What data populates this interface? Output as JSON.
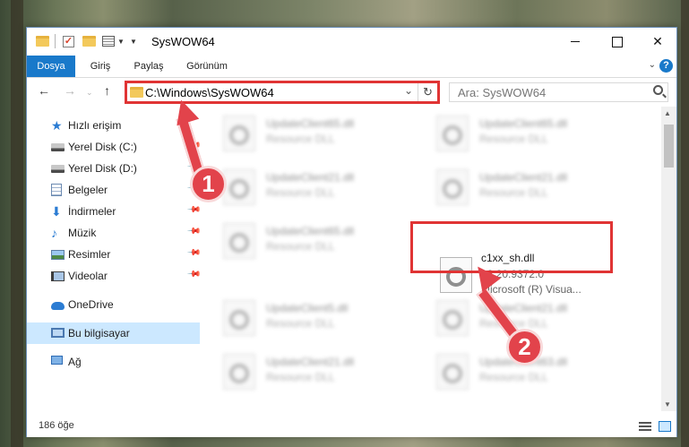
{
  "window": {
    "title": "SysWOW64"
  },
  "ribbon": {
    "tabs": [
      {
        "label": "Dosya",
        "active": true
      },
      {
        "label": "Giriş",
        "active": false
      },
      {
        "label": "Paylaş",
        "active": false
      },
      {
        "label": "Görünüm",
        "active": false
      }
    ],
    "help": "?"
  },
  "address": {
    "path": "C:\\Windows\\SysWOW64",
    "search_placeholder": "Ara: SysWOW64"
  },
  "sidebar": {
    "items": [
      {
        "label": "Hızlı erişim",
        "icon": "star-icon",
        "pinned": false
      },
      {
        "label": "Yerel Disk (C:)",
        "icon": "disk-icon",
        "pinned": true
      },
      {
        "label": "Yerel Disk (D:)",
        "icon": "disk-icon",
        "pinned": true
      },
      {
        "label": "Belgeler",
        "icon": "documents-icon",
        "pinned": true
      },
      {
        "label": "İndirmeler",
        "icon": "download-icon",
        "pinned": true
      },
      {
        "label": "Müzik",
        "icon": "music-icon",
        "pinned": true
      },
      {
        "label": "Resimler",
        "icon": "pictures-icon",
        "pinned": true
      },
      {
        "label": "Videolar",
        "icon": "videos-icon",
        "pinned": true
      },
      {
        "label": "OneDrive",
        "icon": "onedrive-icon",
        "pinned": false
      },
      {
        "label": "Bu bilgisayar",
        "icon": "this-pc-icon",
        "pinned": false,
        "selected": true
      },
      {
        "label": "Ağ",
        "icon": "network-icon",
        "pinned": false
      }
    ]
  },
  "files": [
    {
      "name": "UpdateClient65.dll",
      "type": "Resource DLL"
    },
    {
      "name": "UpdateClient65.dll",
      "type": "Resource DLL"
    },
    {
      "name": "UpdateClient21.dll",
      "type": "Resource DLL"
    },
    {
      "name": "UpdateClient21.dll",
      "type": "Resource DLL"
    },
    {
      "name": "UpdateClient65.dll",
      "type": "Resource DLL"
    },
    {
      "name": "c1xx_sh.dll",
      "version": "12.20.9372.0",
      "type": "Microsoft (R) Visua...",
      "highlighted": true
    },
    {
      "name": "UpdateClient5.dll",
      "type": "Resource DLL"
    },
    {
      "name": "UpdateClient21.dll",
      "type": "Resource DLL"
    },
    {
      "name": "UpdateClient21.dll",
      "type": "Resource DLL"
    },
    {
      "name": "UpdateClient63.dll",
      "type": "Resource DLL"
    }
  ],
  "status": {
    "item_count": "186 öğe"
  },
  "annotations": {
    "badge1": "1",
    "badge2": "2",
    "color": "#e2434b"
  }
}
